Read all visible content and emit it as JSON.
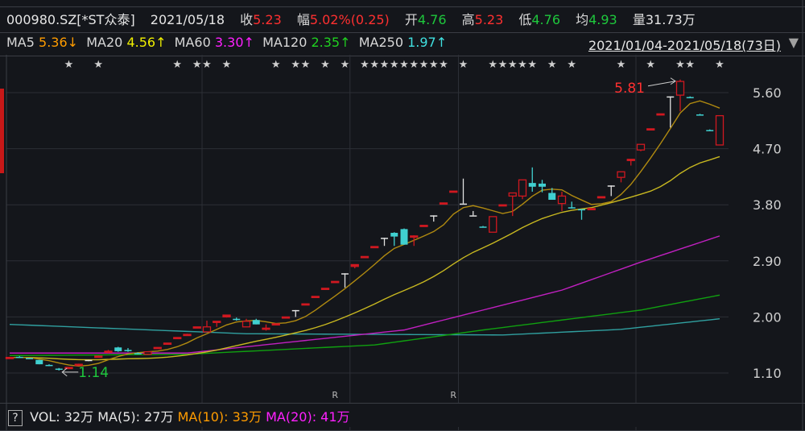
{
  "header": {
    "code": "000980.SZ[*ST众泰]",
    "date": "2021/05/18",
    "close_label": "收",
    "close": "5.23",
    "change_label": "幅",
    "change": "5.02%(0.25)",
    "open_label": "开",
    "open": "4.76",
    "high_label": "高",
    "high": "5.23",
    "low_label": "低",
    "low": "4.76",
    "avg_label": "均",
    "avg": "4.93",
    "vol_label": "量",
    "vol": "31.73万"
  },
  "ma_legend": [
    {
      "label": "MA5",
      "value": "5.36↓",
      "color": "#ff9c00"
    },
    {
      "label": "MA20",
      "value": "4.56↑",
      "color": "#f0f000"
    },
    {
      "label": "MA60",
      "value": "3.30↑",
      "color": "#ff20ff"
    },
    {
      "label": "MA120",
      "value": "2.35↑",
      "color": "#20d020"
    },
    {
      "label": "MA250",
      "value": "1.97↑",
      "color": "#40e0e0"
    }
  ],
  "date_range": "2021/01/04-2021/05/18(73日)",
  "dropdown_icon": "triangle-down-icon",
  "volume_legend": {
    "help": "?",
    "vol": "VOL: 32万",
    "ma5": "MA(5): 27万",
    "ma10": "MA(10): 33万",
    "ma20": "MA(20): 41万"
  },
  "chart_data": {
    "type": "candlestick",
    "ohlc_order": [
      "open",
      "high",
      "low",
      "close"
    ],
    "yticks": [
      "5.60",
      "4.70",
      "3.80",
      "2.90",
      "2.00",
      "1.10"
    ],
    "ylim": [
      1.1,
      5.6
    ],
    "candles": [
      [
        1.345,
        1.36,
        1.34,
        1.35
      ],
      [
        1.36,
        1.37,
        1.35,
        1.35
      ],
      [
        1.34,
        1.34,
        1.33,
        1.33
      ],
      [
        1.31,
        1.31,
        1.24,
        1.24
      ],
      [
        1.23,
        1.24,
        1.21,
        1.22
      ],
      [
        1.17,
        1.18,
        1.14,
        1.16
      ],
      [
        1.18,
        1.19,
        1.17,
        1.19
      ],
      [
        1.23,
        1.25,
        1.22,
        1.24
      ],
      [
        1.31,
        1.31,
        1.29,
        1.31
      ],
      [
        1.36,
        1.38,
        1.35,
        1.37
      ],
      [
        1.43,
        1.47,
        1.42,
        1.45
      ],
      [
        1.51,
        1.52,
        1.44,
        1.45
      ],
      [
        1.47,
        1.5,
        1.44,
        1.45
      ],
      [
        1.42,
        1.43,
        1.4,
        1.41
      ],
      [
        1.4,
        1.45,
        1.39,
        1.44
      ],
      [
        1.5,
        1.51,
        1.49,
        1.51
      ],
      [
        1.57,
        1.58,
        1.56,
        1.58
      ],
      [
        1.66,
        1.67,
        1.65,
        1.67
      ],
      [
        1.71,
        1.73,
        1.7,
        1.72
      ],
      [
        1.83,
        1.84,
        1.82,
        1.84
      ],
      [
        1.76,
        1.94,
        1.76,
        1.84
      ],
      [
        1.92,
        1.93,
        1.84,
        1.93
      ],
      [
        2.0,
        2.03,
        1.99,
        2.03
      ],
      [
        1.97,
        1.99,
        1.94,
        1.95
      ],
      [
        1.84,
        1.97,
        1.84,
        1.93
      ],
      [
        1.95,
        1.97,
        1.88,
        1.88
      ],
      [
        1.81,
        1.88,
        1.78,
        1.82
      ],
      [
        1.88,
        1.89,
        1.87,
        1.89
      ],
      [
        1.99,
        2.0,
        1.98,
        2.0
      ],
      [
        2.11,
        2.11,
        2.0,
        2.11
      ],
      [
        2.2,
        2.21,
        2.19,
        2.21
      ],
      [
        2.32,
        2.33,
        2.31,
        2.33
      ],
      [
        2.45,
        2.46,
        2.44,
        2.46
      ],
      [
        2.56,
        2.57,
        2.55,
        2.57
      ],
      [
        2.7,
        2.7,
        2.47,
        2.7
      ],
      [
        2.81,
        2.84,
        2.78,
        2.84
      ],
      [
        2.96,
        2.97,
        2.95,
        2.97
      ],
      [
        3.12,
        3.13,
        3.11,
        3.13
      ],
      [
        3.27,
        3.27,
        3.14,
        3.27
      ],
      [
        3.35,
        3.36,
        3.14,
        3.29
      ],
      [
        3.41,
        3.42,
        3.16,
        3.16
      ],
      [
        3.28,
        3.31,
        3.14,
        3.3
      ],
      [
        3.46,
        3.47,
        3.45,
        3.47
      ],
      [
        3.63,
        3.63,
        3.53,
        3.63
      ],
      [
        3.82,
        3.83,
        3.81,
        3.83
      ],
      [
        4.01,
        4.02,
        4.0,
        4.02
      ],
      [
        3.82,
        4.22,
        3.82,
        3.82
      ],
      [
        3.63,
        3.7,
        3.63,
        3.63
      ],
      [
        3.45,
        3.46,
        3.44,
        3.44
      ],
      [
        3.36,
        3.61,
        3.36,
        3.61
      ],
      [
        3.79,
        3.8,
        3.78,
        3.8
      ],
      [
        3.94,
        3.99,
        3.62,
        3.99
      ],
      [
        3.94,
        4.2,
        3.89,
        4.2
      ],
      [
        4.15,
        4.4,
        4.01,
        4.09
      ],
      [
        4.14,
        4.2,
        4.0,
        4.09
      ],
      [
        3.99,
        4.07,
        3.88,
        3.88
      ],
      [
        3.82,
        4.01,
        3.7,
        3.94
      ],
      [
        3.76,
        3.85,
        3.74,
        3.75
      ],
      [
        3.73,
        3.73,
        3.56,
        3.72
      ],
      [
        3.73,
        3.74,
        3.72,
        3.74
      ],
      [
        3.92,
        3.93,
        3.91,
        3.93
      ],
      [
        4.11,
        4.11,
        3.94,
        4.11
      ],
      [
        4.24,
        4.33,
        4.16,
        4.33
      ],
      [
        4.51,
        4.53,
        4.43,
        4.53
      ],
      [
        4.68,
        4.77,
        4.66,
        4.77
      ],
      [
        5.01,
        5.02,
        5.0,
        5.02
      ],
      [
        5.25,
        5.26,
        5.24,
        5.26
      ],
      [
        5.54,
        5.54,
        5.04,
        5.54
      ],
      [
        5.56,
        5.81,
        5.3,
        5.78
      ],
      [
        5.53,
        5.54,
        5.52,
        5.52
      ],
      [
        5.25,
        5.26,
        5.24,
        5.24
      ],
      [
        5.0,
        5.01,
        4.99,
        4.99
      ],
      [
        4.76,
        5.23,
        4.76,
        5.23
      ]
    ],
    "ma_lines": {
      "MA60": {
        "color": "#c020c0",
        "points": [
          [
            0,
            1.42
          ],
          [
            18,
            1.42
          ],
          [
            40,
            1.79
          ],
          [
            48,
            2.11
          ],
          [
            56,
            2.43
          ],
          [
            64,
            2.88
          ],
          [
            72,
            3.3
          ]
        ]
      },
      "MA120": {
        "color": "#10a010",
        "points": [
          [
            0,
            1.38
          ],
          [
            18,
            1.4
          ],
          [
            37,
            1.55
          ],
          [
            48,
            1.79
          ],
          [
            64,
            2.11
          ],
          [
            72,
            2.35
          ]
        ]
      },
      "MA250": {
        "color": "#30a0a0",
        "points": [
          [
            0,
            1.88
          ],
          [
            24,
            1.73
          ],
          [
            50,
            1.71
          ],
          [
            62,
            1.8
          ],
          [
            72,
            1.97
          ]
        ]
      },
      "MA5": {
        "color": "#b08a10"
      },
      "MA20": {
        "color": "#c8b820"
      }
    },
    "star_days": [
      6,
      9,
      17,
      19,
      20,
      22,
      27,
      29,
      30,
      32,
      34,
      36,
      37,
      38,
      39,
      40,
      41,
      42,
      43,
      44,
      46,
      49,
      50,
      51,
      52,
      53,
      55,
      57,
      62,
      65,
      68,
      69,
      72
    ],
    "r_marker_days": [
      33,
      45
    ],
    "r_marker_label": "R",
    "month_boundary_days": [
      20,
      35,
      46,
      64
    ],
    "high_marker": {
      "day": 68,
      "label": "5.81"
    },
    "low_marker": {
      "day": 5,
      "label": "1.14"
    }
  }
}
